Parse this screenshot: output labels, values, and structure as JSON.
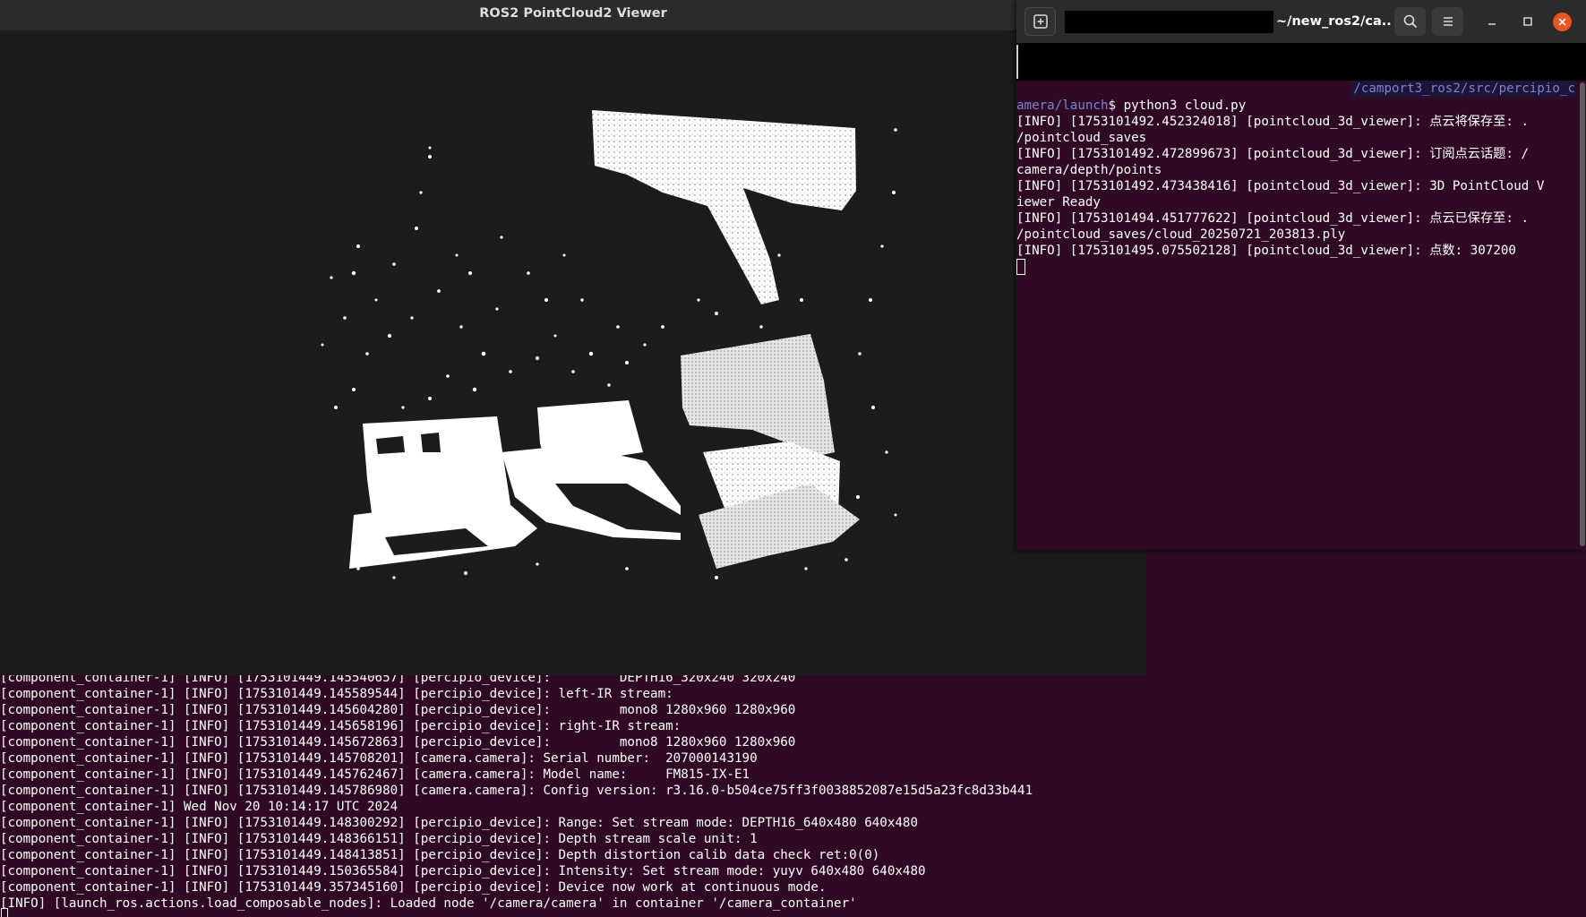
{
  "colors": {
    "terminal_bg": "#300a24",
    "viewer_bg": "#1c1c1c",
    "prompt_path": "#7a82d8",
    "close_button": "#e95420"
  },
  "viewer": {
    "title": "ROS2 PointCloud2 Viewer"
  },
  "terminal": {
    "title": "~/new_ros2/ca...",
    "icons": {
      "new_tab": "new-tab-icon",
      "search": "search-icon",
      "menu": "hamburger-menu-icon",
      "minimize": "minimize-icon",
      "maximize": "maximize-icon",
      "close": "close-icon"
    },
    "path_tail": "/camport3_ros2/src/percipio_c",
    "prompt_path": "amera/launch",
    "prompt_symbol": "$ ",
    "command": "python3 cloud.py",
    "lines": [
      "[INFO] [1753101492.452324018] [pointcloud_3d_viewer]: 点云将保存至: .",
      "/pointcloud_saves",
      "[INFO] [1753101492.472899673] [pointcloud_3d_viewer]: 订阅点云话题: /",
      "camera/depth/points",
      "[INFO] [1753101492.473438416] [pointcloud_3d_viewer]: 3D PointCloud V",
      "iewer Ready",
      "[INFO] [1753101494.451777622] [pointcloud_3d_viewer]: 点云已保存至: .",
      "/pointcloud_saves/cloud_20250721_203813.ply",
      "[INFO] [1753101495.075502128] [pointcloud_3d_viewer]: 点数: 307200"
    ]
  },
  "background_terminal": {
    "lines": [
      "[component_container-1] [INFO] [1753101449.145540657] [percipio_device]:         DEPTH16_320x240 320x240",
      "[component_container-1] [INFO] [1753101449.145589544] [percipio_device]: left-IR stream:",
      "[component_container-1] [INFO] [1753101449.145604280] [percipio_device]:         mono8 1280x960 1280x960",
      "[component_container-1] [INFO] [1753101449.145658196] [percipio_device]: right-IR stream:",
      "[component_container-1] [INFO] [1753101449.145672863] [percipio_device]:         mono8 1280x960 1280x960",
      "[component_container-1] [INFO] [1753101449.145708201] [camera.camera]: Serial number:  207000143190",
      "[component_container-1] [INFO] [1753101449.145762467] [camera.camera]: Model name:     FM815-IX-E1",
      "[component_container-1] [INFO] [1753101449.145786980] [camera.camera]: Config version: r3.16.0-b504ce75ff3f0038852087e15d5a23fc8d33b441",
      "[component_container-1] Wed Nov 20 10:14:17 UTC 2024",
      "[component_container-1] [INFO] [1753101449.148300292] [percipio_device]: Range: Set stream mode: DEPTH16_640x480 640x480",
      "[component_container-1] [INFO] [1753101449.148366151] [percipio_device]: Depth stream scale unit: 1",
      "[component_container-1] [INFO] [1753101449.148413851] [percipio_device]: Depth distortion calib data check ret:0(0)",
      "[component_container-1] [INFO] [1753101449.150365584] [percipio_device]: Intensity: Set stream mode: yuyv 640x480 640x480",
      "[component_container-1] [INFO] [1753101449.357345160] [percipio_device]: Device now work at continuous mode.",
      "[INFO] [launch_ros.actions.load_composable_nodes]: Loaded node '/camera/camera' in container '/camera_container'"
    ]
  }
}
